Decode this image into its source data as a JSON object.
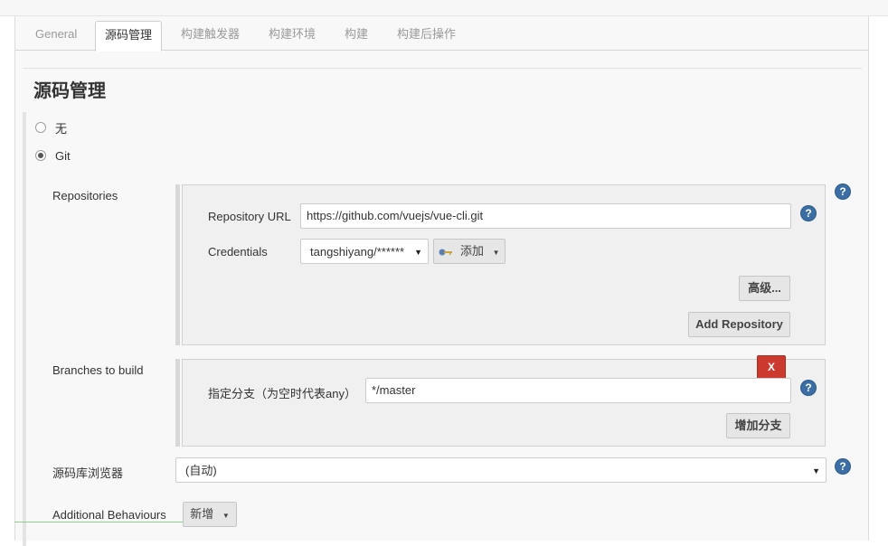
{
  "tabs": [
    {
      "label": "General"
    },
    {
      "label": "源码管理"
    },
    {
      "label": "构建触发器"
    },
    {
      "label": "构建环境"
    },
    {
      "label": "构建"
    },
    {
      "label": "构建后操作"
    }
  ],
  "section_title": "源码管理",
  "scm_options": [
    {
      "label": "无",
      "checked": false
    },
    {
      "label": "Git",
      "checked": true
    }
  ],
  "repositories": {
    "label": "Repositories",
    "url_label": "Repository URL",
    "url_value": "https://github.com/vuejs/vue-cli.git",
    "credentials_label": "Credentials",
    "credentials_value": "tangshiyang/******",
    "add_label": "添加",
    "advanced_label": "高级...",
    "add_repository_label": "Add Repository"
  },
  "branches": {
    "label": "Branches to build",
    "delete_label": "X",
    "branch_label": "指定分支（为空时代表any）",
    "branch_value": "*/master",
    "add_branch_label": "增加分支"
  },
  "repo_browser": {
    "label": "源码库浏览器",
    "value": "(自动)"
  },
  "additional": {
    "label": "Additional Behaviours",
    "add_label": "新增"
  },
  "help_glyph": "?"
}
